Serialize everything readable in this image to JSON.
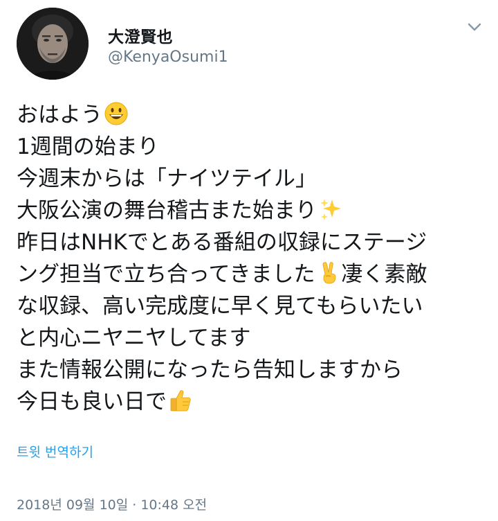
{
  "user": {
    "display_name": "大澄賢也",
    "handle": "@KenyaOsumi1",
    "avatar_icon": "profile-photo"
  },
  "menu_icon": "chevron-down-icon",
  "tweet": {
    "lines": [
      {
        "text": "おはよう",
        "emoji": "grinning-face"
      },
      {
        "text": "1週間の始まり"
      },
      {
        "text": "今週末からは「ナイツテイル」"
      },
      {
        "text": "大阪公演の舞台稽古また始まり",
        "emoji": "sparkles"
      },
      {
        "text": "昨日はNHKでとある番組の収録にステージ"
      },
      {
        "text": "ング担当で立ち合ってきました",
        "emoji": "victory-hand",
        "after": "凄く素敵"
      },
      {
        "text": "な収録、高い完成度に早く見てもらいたい"
      },
      {
        "text": "と内心ニヤニヤしてます"
      },
      {
        "text": "また情報公開になったら告知しますから"
      },
      {
        "text": "今日も良い日で",
        "emoji": "thumbs-up"
      }
    ]
  },
  "translate_label": "트윗 번역하기",
  "timestamp": "2018년 09월 10일 · 10:48 오전",
  "colors": {
    "text": "#14171a",
    "secondary": "#657786",
    "link": "#1da1f2"
  }
}
